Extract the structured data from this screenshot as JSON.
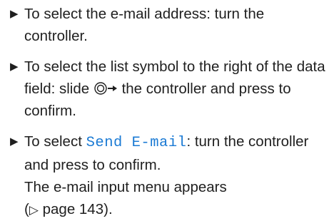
{
  "bullet_glyph": "▶",
  "steps": [
    {
      "text": "To select the e-mail address: turn the controller."
    },
    {
      "text_before": "To select the list symbol to the right of the data field: slide",
      "controller_icon": "controller-slide-right-icon",
      "text_after": "the controller and press to confirm."
    },
    {
      "text_before": "To select",
      "display_text": "Send E-mail",
      "text_after": ": turn the controller and press to confirm.",
      "result_line1": "The e-mail input menu appears",
      "result_ref_glyph": "▷",
      "result_ref_text": "page 143",
      "result_ref_open": "(",
      "result_ref_close": ")."
    }
  ],
  "colors": {
    "text": "#1f1f1f",
    "display_text": "#1a7ad4"
  }
}
